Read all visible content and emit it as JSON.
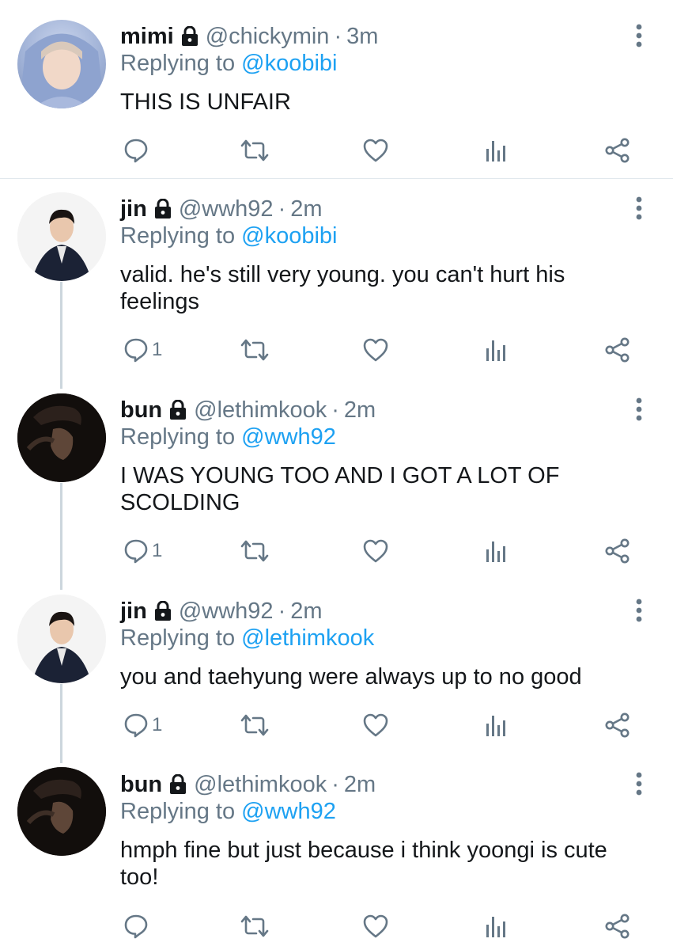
{
  "tweets": [
    {
      "name": "mimi",
      "handle": "@chickymin",
      "dot": "·",
      "time": "3m",
      "replying_prefix": "Replying to",
      "replying_to": "@koobibi",
      "text": "THIS IS UNFAIR",
      "reply_count": "",
      "avatar": "avatar-mimi"
    },
    {
      "name": "jin",
      "handle": "@wwh92",
      "dot": "·",
      "time": "2m",
      "replying_prefix": "Replying to",
      "replying_to": "@koobibi",
      "text_line1": "valid. he's still very young. you can't hurt his",
      "text_line2": "feelings",
      "reply_count": "1",
      "avatar": "avatar-jin"
    },
    {
      "name": "bun",
      "handle": "@lethimkook",
      "dot": "·",
      "time": "2m",
      "replying_prefix": "Replying to",
      "replying_to": "@wwh92",
      "text_line1": "I WAS YOUNG TOO AND I GOT A LOT OF",
      "text_line2": "SCOLDING",
      "reply_count": "1",
      "avatar": "avatar-bun"
    },
    {
      "name": "jin",
      "handle": "@wwh92",
      "dot": "·",
      "time": "2m",
      "replying_prefix": "Replying to",
      "replying_to": "@lethimkook",
      "text": "you and taehyung were always up to no good",
      "reply_count": "1",
      "avatar": "avatar-jin"
    },
    {
      "name": "bun",
      "handle": "@lethimkook",
      "dot": "·",
      "time": "2m",
      "replying_prefix": "Replying to",
      "replying_to": "@wwh92",
      "text_line1": "hmph fine but just because i think yoongi is cute",
      "text_line2": "too!",
      "reply_count": "",
      "avatar": "avatar-bun"
    }
  ],
  "icons": {
    "lock": "lock-icon",
    "more": "more-vertical-icon",
    "reply": "reply-icon",
    "retweet": "retweet-icon",
    "like": "heart-icon",
    "analytics": "analytics-icon",
    "share": "share-icon"
  },
  "colors": {
    "text": "#14171a",
    "secondary": "#657786",
    "link": "#1da1f2",
    "divider": "#e1e8ed",
    "thread_line": "#ccd6dd"
  }
}
